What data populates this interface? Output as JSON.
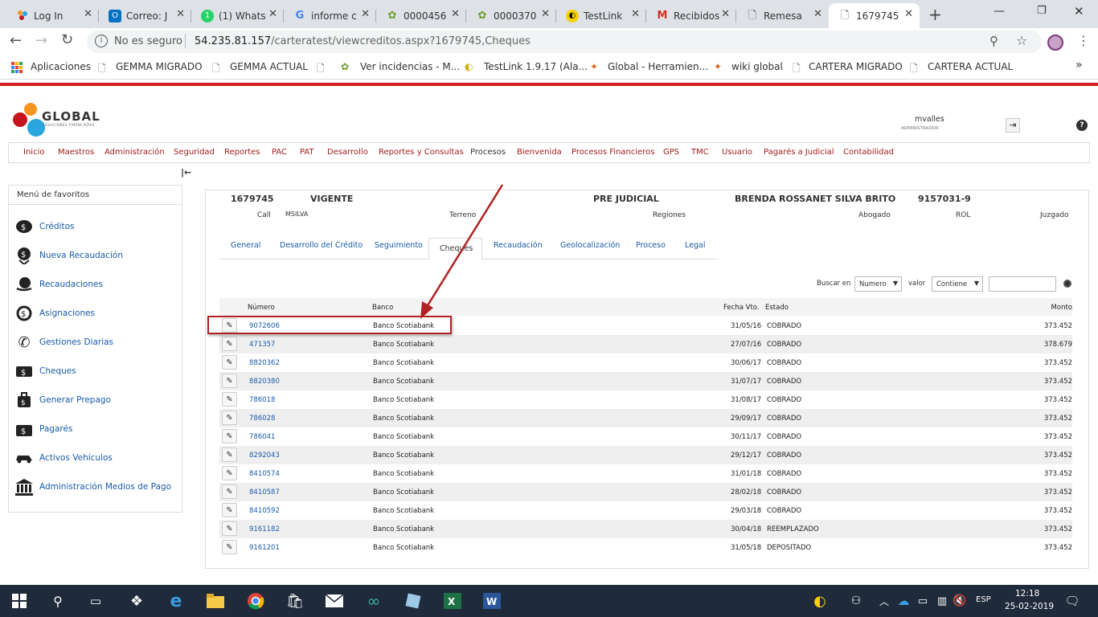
{
  "browser": {
    "tabs": [
      {
        "label": "Log In",
        "icon": "global-logo-icon"
      },
      {
        "label": "Correo: J",
        "icon": "outlook-icon"
      },
      {
        "label": "(1) Whats",
        "icon": "whatsapp-icon"
      },
      {
        "label": "informe c",
        "icon": "google-icon"
      },
      {
        "label": "0000456",
        "icon": "bug-tracker-icon"
      },
      {
        "label": "0000370",
        "icon": "bug-tracker-icon"
      },
      {
        "label": "TestLink",
        "icon": "testlink-icon"
      },
      {
        "label": "Recibidos",
        "icon": "gmail-icon"
      },
      {
        "label": "Remesa",
        "icon": "page-icon"
      },
      {
        "label": "1679745",
        "icon": "page-icon"
      }
    ],
    "security_label": "No es seguro",
    "url_host": "54.235.81.157",
    "url_path": "/carteratest/viewcreditos.aspx?1679745,Cheques",
    "bookmarks": [
      "Aplicaciones",
      "GEMMA MIGRADO",
      "GEMMA ACTUAL",
      "Ver incidencias - M...",
      "TestLink 1.9.17 (Ala...",
      "Global - Herramien...",
      "wiki global",
      "CARTERA MIGRADO",
      "CARTERA ACTUAL"
    ],
    "more_bookmarks": "»"
  },
  "app": {
    "logo_text": "GLOBAL",
    "logo_subtext": "SOLUCIONES FINANCIERAS",
    "user_name": "mvalles",
    "user_role": "ADMINISTRADOR",
    "help_label": "?",
    "collapse_label": "|←",
    "menu": [
      "Inicio",
      "Maestros",
      "Administración",
      "Seguridad",
      "Reportes",
      "PAC",
      "PAT",
      "Desarrollo",
      "Reportes y Consultas",
      "Procesos",
      "Bienvenida",
      "Procesos Financieros",
      "GPS",
      "TMC",
      "Usuario",
      "Pagarés a Judicial",
      "Contabilidad"
    ]
  },
  "favorites": {
    "title": "Menú de favoritos",
    "items": [
      {
        "label": "Créditos",
        "icon": "credit-icon"
      },
      {
        "label": "Nueva Recaudación",
        "icon": "money-add-icon"
      },
      {
        "label": "Recaudaciones",
        "icon": "money-hand-icon"
      },
      {
        "label": "Asignaciones",
        "icon": "refresh-money-icon"
      },
      {
        "label": "Gestiones Diarias",
        "icon": "phone-icon"
      },
      {
        "label": "Cheques",
        "icon": "cheque-icon"
      },
      {
        "label": "Generar Prepago",
        "icon": "bag-money-icon"
      },
      {
        "label": "Pagarés",
        "icon": "promissory-icon"
      },
      {
        "label": "Activos Vehículos",
        "icon": "car-icon"
      },
      {
        "label": "Administración Medios de Pago",
        "icon": "bank-icon"
      }
    ]
  },
  "credit": {
    "number": "1679745",
    "status": "VIGENTE",
    "stage": "PRE JUDICIAL",
    "client_name": "BRENDA ROSSANET SILVA BRITO",
    "client_rut": "9157031-9",
    "call_label": "Call",
    "call_value": "MSILVA",
    "terreno_label": "Terreno",
    "regiones_label": "Regiones",
    "abogado_label": "Abogado",
    "rol_label": "ROL",
    "juzgado_label": "Juzgado"
  },
  "content_tabs": [
    "General",
    "Desarrollo del Crédito",
    "Seguimiento",
    "Cheques",
    "Recaudación",
    "Geolocalización",
    "Proceso",
    "Legal"
  ],
  "active_tab": "Cheques",
  "search": {
    "buscar_label": "Buscar en",
    "field_value": "Numero",
    "valor_label": "valor",
    "op_value": "Contiene",
    "input_value": ""
  },
  "table": {
    "headers": {
      "numero": "Número",
      "banco": "Banco",
      "fecha": "Fecha Vto.",
      "estado": "Estado",
      "monto": "Monto"
    },
    "rows": [
      {
        "numero": "9072606",
        "banco": "Banco Scotiabank",
        "fecha": "31/05/16",
        "estado": "COBRADO",
        "monto": "373.452"
      },
      {
        "numero": "471357",
        "banco": "Banco Scotiabank",
        "fecha": "27/07/16",
        "estado": "COBRADO",
        "monto": "378.679"
      },
      {
        "numero": "8820362",
        "banco": "Banco Scotiabank",
        "fecha": "30/06/17",
        "estado": "COBRADO",
        "monto": "373.452"
      },
      {
        "numero": "8820380",
        "banco": "Banco Scotiabank",
        "fecha": "31/07/17",
        "estado": "COBRADO",
        "monto": "373.452"
      },
      {
        "numero": "786018",
        "banco": "Banco Scotiabank",
        "fecha": "31/08/17",
        "estado": "COBRADO",
        "monto": "373.452"
      },
      {
        "numero": "786028",
        "banco": "Banco Scotiabank",
        "fecha": "29/09/17",
        "estado": "COBRADO",
        "monto": "373.452"
      },
      {
        "numero": "786041",
        "banco": "Banco Scotiabank",
        "fecha": "30/11/17",
        "estado": "COBRADO",
        "monto": "373.452"
      },
      {
        "numero": "8292043",
        "banco": "Banco Scotiabank",
        "fecha": "29/12/17",
        "estado": "COBRADO",
        "monto": "373.452"
      },
      {
        "numero": "8410574",
        "banco": "Banco Scotiabank",
        "fecha": "31/01/18",
        "estado": "COBRADO",
        "monto": "373.452"
      },
      {
        "numero": "8410587",
        "banco": "Banco Scotiabank",
        "fecha": "28/02/18",
        "estado": "COBRADO",
        "monto": "373.452"
      },
      {
        "numero": "8410592",
        "banco": "Banco Scotiabank",
        "fecha": "29/03/18",
        "estado": "COBRADO",
        "monto": "373.452"
      },
      {
        "numero": "9161182",
        "banco": "Banco Scotiabank",
        "fecha": "30/04/18",
        "estado": "REEMPLAZADO",
        "monto": "373.452"
      },
      {
        "numero": "9161201",
        "banco": "Banco Scotiabank",
        "fecha": "31/05/18",
        "estado": "DEPOSITADO",
        "monto": "373.452"
      }
    ]
  },
  "annotation": {
    "color": "#b22222"
  },
  "taskbar": {
    "time": "12:18",
    "date": "25-02-2019",
    "language": "ESP"
  },
  "colors": {
    "accent_red": "#a31d20",
    "link_blue": "#1a5aa8",
    "taskbar": "#1f2a3a"
  }
}
